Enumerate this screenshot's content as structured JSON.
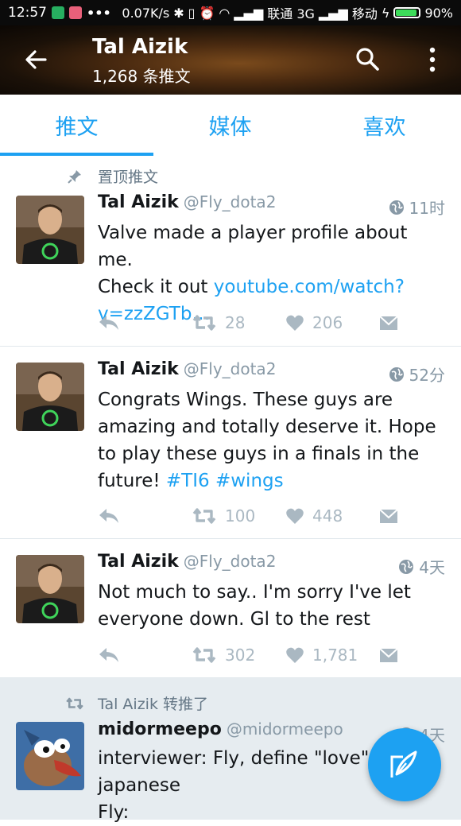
{
  "status_bar": {
    "time": "12:57",
    "speed": "0.07K/s",
    "carrier1": "联通 3G",
    "carrier2": "移动",
    "battery": "90%",
    "battery_level": 0.9
  },
  "header": {
    "title": "Tal Aizik",
    "subtitle": "1,268 条推文"
  },
  "tabs": [
    {
      "label": "推文",
      "active": true
    },
    {
      "label": "媒体",
      "active": false
    },
    {
      "label": "喜欢",
      "active": false
    }
  ],
  "tweets": [
    {
      "context": "置顶推文",
      "name": "Tal Aizik",
      "handle": "@Fly_dota2",
      "time": "11时",
      "text_lines": [
        "Valve made a player profile about me.",
        "Check it out "
      ],
      "link_lines": [
        "youtube.com/watch?",
        "v=zzZGTb…"
      ],
      "retweets": "28",
      "likes": "206"
    },
    {
      "name": "Tal Aizik",
      "handle": "@Fly_dota2",
      "time": "52分",
      "text_lines": [
        "Congrats Wings. These guys are",
        "amazing and totally deserve it. Hope",
        "to play these guys in a finals in the",
        "future! "
      ],
      "hashtags": [
        "#TI6",
        "#wings"
      ],
      "retweets": "100",
      "likes": "448"
    },
    {
      "name": "Tal Aizik",
      "handle": "@Fly_dota2",
      "time": "4天",
      "text_lines": [
        "Not much to say.. I'm sorry I've let",
        "everyone down.  Gl to the rest"
      ],
      "retweets": "302",
      "likes": "1,781"
    },
    {
      "context": "Tal Aizik 转推了",
      "name": "midormeepo",
      "handle": "@midormeepo",
      "time": "4天",
      "text_lines": [
        "interviewer: Fly, define \"love\" in",
        "japanese",
        "Fly:"
      ]
    }
  ],
  "colors": {
    "accent": "#1da1f2",
    "muted": "#8899a6",
    "action_gray": "#aab8c2",
    "retweet_bg": "#e6ecf0"
  },
  "icons": [
    "back-arrow-icon",
    "search-icon",
    "more-vert-icon",
    "pin-icon",
    "globe-icon",
    "reply-icon",
    "retweet-icon",
    "heart-icon",
    "message-icon",
    "compose-icon"
  ]
}
